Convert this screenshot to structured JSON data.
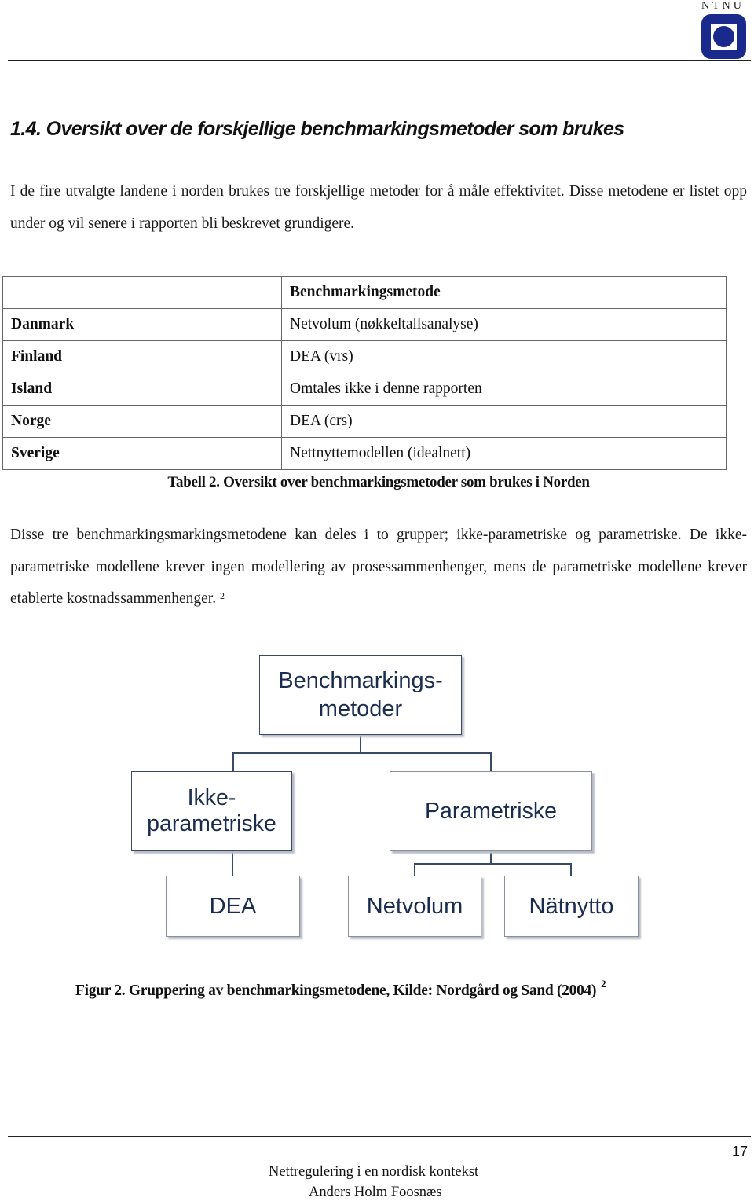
{
  "header": {
    "logo_text": "NTNU",
    "logo_icon": "ntnu-logo-icon",
    "brand_color": "#1a2a8c"
  },
  "section": {
    "heading": "1.4. Oversikt over de forskjellige benchmarkingsmetoder som brukes",
    "intro_paragraph": "I de fire utvalgte landene i norden brukes tre forskjellige metoder for å måle effektivitet. Disse metodene er listet opp under og vil senere i rapporten bli beskrevet grundigere."
  },
  "table": {
    "header": [
      "",
      "Benchmarkingsmetode"
    ],
    "rows": [
      {
        "country": "Danmark",
        "method": "Netvolum (nøkkeltallsanalyse)"
      },
      {
        "country": "Finland",
        "method": "DEA (vrs)"
      },
      {
        "country": "Island",
        "method": "Omtales ikke i denne rapporten"
      },
      {
        "country": "Norge",
        "method": "DEA (crs)"
      },
      {
        "country": "Sverige",
        "method": "Nettnyttemodellen (idealnett)"
      }
    ],
    "caption": "Tabell 2. Oversikt over benchmarkingsmetoder som brukes i Norden"
  },
  "body_paragraph": {
    "text": "Disse tre benchmarkingsmarkingsmetodene kan deles i to grupper; ikke-parametriske og parametriske. De ikke-parametriske modellene krever ingen modellering av prosessammenhenger, mens de parametriske modellene krever etablerte kostnadssammenhenger.",
    "footnote_ref": "2"
  },
  "diagram": {
    "root": {
      "label_line1": "Benchmarkings-",
      "label_line2": "metoder"
    },
    "groups": [
      {
        "label": "Ikke-parametriske",
        "children": [
          "DEA"
        ]
      },
      {
        "label": "Parametriske",
        "children": [
          "Netvolum",
          "Nätnytto"
        ]
      }
    ],
    "text_color": "#1b2d4f"
  },
  "figure_caption": {
    "text": "Figur 2. Gruppering av benchmarkingsmetodene, Kilde: Nordgård og Sand (2004)",
    "footnote_ref": "2"
  },
  "footer": {
    "page_number": "17",
    "title": "Nettregulering i en nordisk kontekst",
    "author": "Anders Holm Foosnæs"
  }
}
